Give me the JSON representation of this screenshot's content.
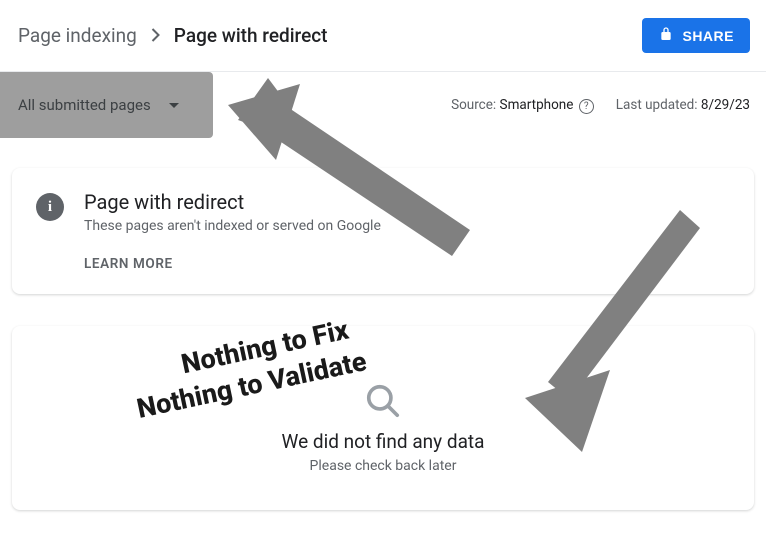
{
  "breadcrumb": {
    "parent": "Page indexing",
    "current": "Page with redirect"
  },
  "share_label": "SHARE",
  "filter": {
    "label": "All submitted pages"
  },
  "meta": {
    "source_label": "Source:",
    "source_value": "Smartphone",
    "updated_label": "Last updated:",
    "updated_value": "8/29/23"
  },
  "info_card": {
    "title": "Page with redirect",
    "subtitle": "These pages aren't indexed or served on Google",
    "learn_more": "LEARN MORE"
  },
  "empty_state": {
    "title": "We did not find any data",
    "subtitle": "Please check back later"
  },
  "annotations": {
    "line1": "Nothing to Fix",
    "line2": "Nothing to Validate"
  }
}
